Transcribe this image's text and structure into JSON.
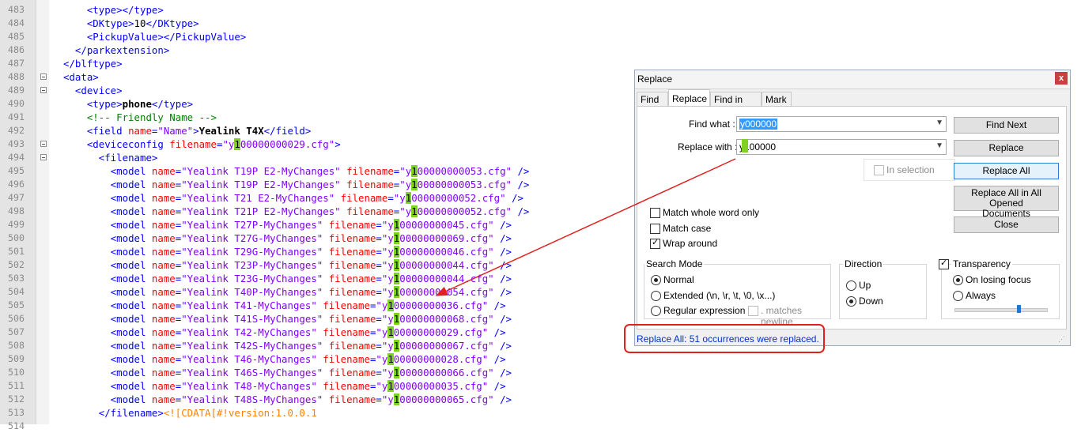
{
  "editor": {
    "lines": [
      {
        "n": "483",
        "fold": false,
        "indent": "      ",
        "segs": [
          [
            "t",
            "<type></type>"
          ]
        ]
      },
      {
        "n": "484",
        "fold": false,
        "indent": "      ",
        "segs": [
          [
            "t",
            "<DKtype>"
          ],
          [
            "p",
            "10"
          ],
          [
            "t",
            "</DKtype>"
          ]
        ]
      },
      {
        "n": "485",
        "fold": false,
        "indent": "      ",
        "segs": [
          [
            "t",
            "<PickupValue></PickupValue>"
          ]
        ]
      },
      {
        "n": "486",
        "fold": false,
        "indent": "    ",
        "segs": [
          [
            "t",
            "</parkextension>"
          ]
        ]
      },
      {
        "n": "487",
        "fold": false,
        "indent": "  ",
        "segs": [
          [
            "t",
            "</blftype>"
          ]
        ]
      },
      {
        "n": "488",
        "fold": true,
        "indent": "  ",
        "segs": [
          [
            "t",
            "<data>"
          ]
        ]
      },
      {
        "n": "489",
        "fold": true,
        "indent": "    ",
        "segs": [
          [
            "t",
            "<device>"
          ]
        ]
      },
      {
        "n": "490",
        "fold": false,
        "indent": "      ",
        "segs": [
          [
            "t",
            "<type>"
          ],
          [
            "b",
            "phone"
          ],
          [
            "t",
            "</type>"
          ]
        ]
      },
      {
        "n": "491",
        "fold": false,
        "indent": "      ",
        "segs": [
          [
            "cm",
            "<!-- Friendly Name -->"
          ]
        ]
      },
      {
        "n": "492",
        "fold": false,
        "indent": "      ",
        "segs": [
          [
            "t",
            "<field "
          ],
          [
            "a",
            "name"
          ],
          [
            "t",
            "="
          ],
          [
            "v",
            "\"Name\""
          ],
          [
            "t",
            ">"
          ],
          [
            "b",
            "Yealink T4X"
          ],
          [
            "t",
            "</field>"
          ]
        ]
      },
      {
        "n": "493",
        "fold": true,
        "indent": "      ",
        "segs": [
          [
            "t",
            "<deviceconfig "
          ],
          [
            "a",
            "filename"
          ],
          [
            "t",
            "="
          ],
          [
            "v",
            "\"y"
          ],
          [
            "hl",
            "1"
          ],
          [
            "v",
            "00000000029.cfg\""
          ],
          [
            "t",
            ">"
          ]
        ]
      },
      {
        "n": "494",
        "fold": true,
        "indent": "        ",
        "segs": [
          [
            "t",
            "<filename>"
          ]
        ]
      },
      {
        "n": "495",
        "fold": false,
        "indent": "          ",
        "segs": [
          [
            "t",
            "<model "
          ],
          [
            "a",
            "name"
          ],
          [
            "t",
            "="
          ],
          [
            "v",
            "\"Yealink T19P E2-MyChanges\""
          ],
          [
            "a",
            " filename"
          ],
          [
            "t",
            "="
          ],
          [
            "v",
            "\"y"
          ],
          [
            "hl",
            "1"
          ],
          [
            "v",
            "00000000053.cfg\""
          ],
          [
            "t",
            " />"
          ]
        ]
      },
      {
        "n": "496",
        "fold": false,
        "indent": "          ",
        "segs": [
          [
            "t",
            "<model "
          ],
          [
            "a",
            "name"
          ],
          [
            "t",
            "="
          ],
          [
            "v",
            "\"Yealink T19P E2-MyChanges\""
          ],
          [
            "a",
            " filename"
          ],
          [
            "t",
            "="
          ],
          [
            "v",
            "\"y"
          ],
          [
            "hl",
            "1"
          ],
          [
            "v",
            "00000000053.cfg\""
          ],
          [
            "t",
            " />"
          ]
        ]
      },
      {
        "n": "497",
        "fold": false,
        "indent": "          ",
        "segs": [
          [
            "t",
            "<model "
          ],
          [
            "a",
            "name"
          ],
          [
            "t",
            "="
          ],
          [
            "v",
            "\"Yealink T21 E2-MyChanges\""
          ],
          [
            "a",
            " filename"
          ],
          [
            "t",
            "="
          ],
          [
            "v",
            "\"y"
          ],
          [
            "hl",
            "1"
          ],
          [
            "v",
            "00000000052.cfg\""
          ],
          [
            "t",
            " />"
          ]
        ]
      },
      {
        "n": "498",
        "fold": false,
        "indent": "          ",
        "segs": [
          [
            "t",
            "<model "
          ],
          [
            "a",
            "name"
          ],
          [
            "t",
            "="
          ],
          [
            "v",
            "\"Yealink T21P E2-MyChanges\""
          ],
          [
            "a",
            " filename"
          ],
          [
            "t",
            "="
          ],
          [
            "v",
            "\"y"
          ],
          [
            "hl",
            "1"
          ],
          [
            "v",
            "00000000052.cfg\""
          ],
          [
            "t",
            " />"
          ]
        ]
      },
      {
        "n": "499",
        "fold": false,
        "indent": "          ",
        "segs": [
          [
            "t",
            "<model "
          ],
          [
            "a",
            "name"
          ],
          [
            "t",
            "="
          ],
          [
            "v",
            "\"Yealink T27P-MyChanges\""
          ],
          [
            "a",
            " filename"
          ],
          [
            "t",
            "="
          ],
          [
            "v",
            "\"y"
          ],
          [
            "hl",
            "1"
          ],
          [
            "v",
            "00000000045.cfg\""
          ],
          [
            "t",
            " />"
          ]
        ]
      },
      {
        "n": "500",
        "fold": false,
        "indent": "          ",
        "segs": [
          [
            "t",
            "<model "
          ],
          [
            "a",
            "name"
          ],
          [
            "t",
            "="
          ],
          [
            "v",
            "\"Yealink T27G-MyChanges\""
          ],
          [
            "a",
            " filename"
          ],
          [
            "t",
            "="
          ],
          [
            "v",
            "\"y"
          ],
          [
            "hl",
            "1"
          ],
          [
            "v",
            "00000000069.cfg\""
          ],
          [
            "t",
            " />"
          ]
        ]
      },
      {
        "n": "501",
        "fold": false,
        "indent": "          ",
        "segs": [
          [
            "t",
            "<model "
          ],
          [
            "a",
            "name"
          ],
          [
            "t",
            "="
          ],
          [
            "v",
            "\"Yealink T29G-MyChanges\""
          ],
          [
            "a",
            " filename"
          ],
          [
            "t",
            "="
          ],
          [
            "v",
            "\"y"
          ],
          [
            "hl",
            "1"
          ],
          [
            "v",
            "00000000046.cfg\""
          ],
          [
            "t",
            " />"
          ]
        ]
      },
      {
        "n": "502",
        "fold": false,
        "indent": "          ",
        "segs": [
          [
            "t",
            "<model "
          ],
          [
            "a",
            "name"
          ],
          [
            "t",
            "="
          ],
          [
            "v",
            "\"Yealink T23P-MyChanges\""
          ],
          [
            "a",
            " filename"
          ],
          [
            "t",
            "="
          ],
          [
            "v",
            "\"y"
          ],
          [
            "hl",
            "1"
          ],
          [
            "v",
            "00000000044.cfg\""
          ],
          [
            "t",
            " />"
          ]
        ]
      },
      {
        "n": "503",
        "fold": false,
        "indent": "          ",
        "segs": [
          [
            "t",
            "<model "
          ],
          [
            "a",
            "name"
          ],
          [
            "t",
            "="
          ],
          [
            "v",
            "\"Yealink T23G-MyChanges\""
          ],
          [
            "a",
            " filename"
          ],
          [
            "t",
            "="
          ],
          [
            "v",
            "\"y"
          ],
          [
            "hl",
            "1"
          ],
          [
            "v",
            "00000000044.cfg\""
          ],
          [
            "t",
            " />"
          ]
        ]
      },
      {
        "n": "504",
        "fold": false,
        "indent": "          ",
        "segs": [
          [
            "t",
            "<model "
          ],
          [
            "a",
            "name"
          ],
          [
            "t",
            "="
          ],
          [
            "v",
            "\"Yealink T40P-MyChanges\""
          ],
          [
            "a",
            " filename"
          ],
          [
            "t",
            "="
          ],
          [
            "v",
            "\"y"
          ],
          [
            "hl",
            "1"
          ],
          [
            "v",
            "00000000054.cfg\""
          ],
          [
            "t",
            " />"
          ]
        ]
      },
      {
        "n": "505",
        "fold": false,
        "indent": "          ",
        "segs": [
          [
            "t",
            "<model "
          ],
          [
            "a",
            "name"
          ],
          [
            "t",
            "="
          ],
          [
            "v",
            "\"Yealink T41-MyChanges\""
          ],
          [
            "a",
            " filename"
          ],
          [
            "t",
            "="
          ],
          [
            "v",
            "\"y"
          ],
          [
            "hl",
            "1"
          ],
          [
            "v",
            "00000000036.cfg\""
          ],
          [
            "t",
            " />"
          ]
        ]
      },
      {
        "n": "506",
        "fold": false,
        "indent": "          ",
        "segs": [
          [
            "t",
            "<model "
          ],
          [
            "a",
            "name"
          ],
          [
            "t",
            "="
          ],
          [
            "v",
            "\"Yealink T41S-MyChanges\""
          ],
          [
            "a",
            " filename"
          ],
          [
            "t",
            "="
          ],
          [
            "v",
            "\"y"
          ],
          [
            "hl",
            "1"
          ],
          [
            "v",
            "00000000068.cfg\""
          ],
          [
            "t",
            " />"
          ]
        ]
      },
      {
        "n": "507",
        "fold": false,
        "indent": "          ",
        "segs": [
          [
            "t",
            "<model "
          ],
          [
            "a",
            "name"
          ],
          [
            "t",
            "="
          ],
          [
            "v",
            "\"Yealink T42-MyChanges\""
          ],
          [
            "a",
            " filename"
          ],
          [
            "t",
            "="
          ],
          [
            "v",
            "\"y"
          ],
          [
            "hl",
            "1"
          ],
          [
            "v",
            "00000000029.cfg\""
          ],
          [
            "t",
            " />"
          ]
        ]
      },
      {
        "n": "508",
        "fold": false,
        "indent": "          ",
        "segs": [
          [
            "t",
            "<model "
          ],
          [
            "a",
            "name"
          ],
          [
            "t",
            "="
          ],
          [
            "v",
            "\"Yealink T42S-MyChanges\""
          ],
          [
            "a",
            " filename"
          ],
          [
            "t",
            "="
          ],
          [
            "v",
            "\"y"
          ],
          [
            "hl",
            "1"
          ],
          [
            "v",
            "00000000067.cfg\""
          ],
          [
            "t",
            " />"
          ]
        ]
      },
      {
        "n": "509",
        "fold": false,
        "indent": "          ",
        "segs": [
          [
            "t",
            "<model "
          ],
          [
            "a",
            "name"
          ],
          [
            "t",
            "="
          ],
          [
            "v",
            "\"Yealink T46-MyChanges\""
          ],
          [
            "a",
            " filename"
          ],
          [
            "t",
            "="
          ],
          [
            "v",
            "\"y"
          ],
          [
            "hl",
            "1"
          ],
          [
            "v",
            "00000000028.cfg\""
          ],
          [
            "t",
            " />"
          ]
        ]
      },
      {
        "n": "510",
        "fold": false,
        "indent": "          ",
        "segs": [
          [
            "t",
            "<model "
          ],
          [
            "a",
            "name"
          ],
          [
            "t",
            "="
          ],
          [
            "v",
            "\"Yealink T46S-MyChanges\""
          ],
          [
            "a",
            " filename"
          ],
          [
            "t",
            "="
          ],
          [
            "v",
            "\"y"
          ],
          [
            "hl",
            "1"
          ],
          [
            "v",
            "00000000066.cfg\""
          ],
          [
            "t",
            " />"
          ]
        ]
      },
      {
        "n": "511",
        "fold": false,
        "indent": "          ",
        "segs": [
          [
            "t",
            "<model "
          ],
          [
            "a",
            "name"
          ],
          [
            "t",
            "="
          ],
          [
            "v",
            "\"Yealink T48-MyChanges\""
          ],
          [
            "a",
            " filename"
          ],
          [
            "t",
            "="
          ],
          [
            "v",
            "\"y"
          ],
          [
            "hl",
            "1"
          ],
          [
            "v",
            "00000000035.cfg\""
          ],
          [
            "t",
            " />"
          ]
        ]
      },
      {
        "n": "512",
        "fold": false,
        "indent": "          ",
        "segs": [
          [
            "t",
            "<model "
          ],
          [
            "a",
            "name"
          ],
          [
            "t",
            "="
          ],
          [
            "v",
            "\"Yealink T48S-MyChanges\""
          ],
          [
            "a",
            " filename"
          ],
          [
            "t",
            "="
          ],
          [
            "v",
            "\"y"
          ],
          [
            "hl",
            "1"
          ],
          [
            "v",
            "00000000065.cfg\""
          ],
          [
            "t",
            " />"
          ]
        ]
      },
      {
        "n": "513",
        "fold": false,
        "indent": "        ",
        "segs": [
          [
            "t",
            "</filename>"
          ],
          [
            "cd",
            "<![CDATA[#!version:1.0.0.1"
          ]
        ]
      },
      {
        "n": "514",
        "fold": false,
        "indent": "",
        "segs": []
      }
    ]
  },
  "dialog": {
    "title": "Replace",
    "close_glyph": "x",
    "tabs": [
      "Find",
      "Replace",
      "Find in Files",
      "Mark"
    ],
    "find_label": "Find what :",
    "find_value": "y000000",
    "replace_label": "Replace with :",
    "replace_value": "y100000",
    "in_selection": "In selection",
    "buttons": {
      "find_next": "Find Next",
      "replace": "Replace",
      "replace_all": "Replace All",
      "replace_all_opened_1": "Replace All in All Opened",
      "replace_all_opened_2": "Documents",
      "close": "Close"
    },
    "options": {
      "whole_word": "Match whole word only",
      "match_case": "Match case",
      "wrap_around": "Wrap around"
    },
    "search_mode": {
      "title": "Search Mode",
      "normal": "Normal",
      "extended": "Extended (\\n, \\r, \\t, \\0, \\x...)",
      "regex": "Regular expression",
      "matches_newline": ". matches newline"
    },
    "direction": {
      "title": "Direction",
      "up": "Up",
      "down": "Down"
    },
    "transparency": {
      "title": "Transparency",
      "on_losing_focus": "On losing focus",
      "always": "Always",
      "level": 0.7
    },
    "status": "Replace All: 51 occurrences were replaced."
  },
  "colors": {
    "tag": "#0000ff",
    "attribute": "#ff0000",
    "value": "#8000ff",
    "comment": "#008000",
    "cdata": "#ff8000",
    "highlight": "#7ed321",
    "annotation": "#e02020"
  }
}
